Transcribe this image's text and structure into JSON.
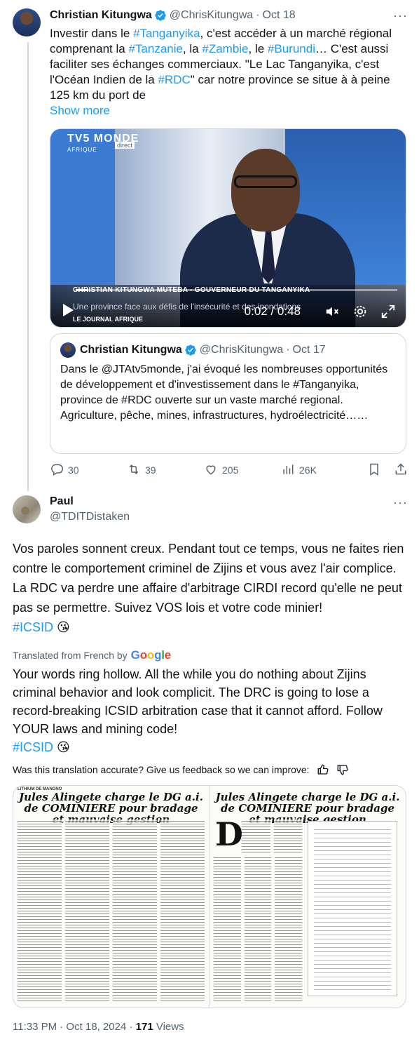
{
  "parent": {
    "name": "Christian Kitungwa",
    "handle": "@ChrisKitungwa",
    "dot": "·",
    "date": "Oct 18",
    "more": "···",
    "text_parts": [
      {
        "t": "Investir dans le ",
        "link": false
      },
      {
        "t": "#Tanganyika",
        "link": true
      },
      {
        "t": ", c'est accéder à un marché régional comprenant la ",
        "link": false
      },
      {
        "t": "#Tanzanie",
        "link": true
      },
      {
        "t": ", la ",
        "link": false
      },
      {
        "t": "#Zambie",
        "link": true
      },
      {
        "t": ", le ",
        "link": false
      },
      {
        "t": "#Burundi",
        "link": true
      },
      {
        "t": "… C'est aussi faciliter ses échanges commerciaux. \"Le Lac Tanganyika, c'est l'Océan Indien de la ",
        "link": false
      },
      {
        "t": "#RDC",
        "link": true
      },
      {
        "t": "\" car notre province se situe à à peine 125 km du port de",
        "link": false
      }
    ],
    "show_more": "Show more",
    "video": {
      "logo": "TV5 MONDE",
      "logo_sub": "AFRIQUE",
      "live_badge": "direct",
      "caption_name": "CHRISTIAN KITUNGWA MUTEBA - GOUVERNEUR DU TANGANYIKA",
      "caption_topic": "Une province face aux défis de l'insécurité et des inondations",
      "caption_show": "LE JOURNAL AFRIQUE",
      "time": "0:02 / 0:48",
      "progress": 0.04
    },
    "quote": {
      "name": "Christian Kitungwa",
      "handle": "@ChrisKitungwa",
      "dot": "·",
      "date": "Oct 17",
      "text": "Dans le @JTAtv5monde, j'ai évoqué les nombreuses opportunités de développement et d'investissement dans le #Tanganyika, province de #RDC ouverte sur un vaste marché regional.\nAgriculture, pêche, mines, infrastructures, hydroélectricité……"
    },
    "actions": {
      "replies": "30",
      "reposts": "39",
      "likes": "205",
      "views": "26K"
    }
  },
  "reply": {
    "name": "Paul",
    "handle": "@TDITDistaken",
    "more": "···",
    "original": "Vos paroles sonnent creux.  Pendant tout ce temps, vous ne faites rien contre le comportement criminel de Zijins et vous avez l'air complice.  La RDC va perdre une affaire d'arbitrage CIRDI record qu'elle ne peut pas se permettre.  Suivez VOS lois et votre code minier!",
    "original_hashtag": "#ICSID",
    "emoji": "😘",
    "translated_label": "Translated from French by",
    "google": [
      "G",
      "o",
      "o",
      "g",
      "l",
      "e"
    ],
    "google_colors": [
      "#4285F4",
      "#EA4335",
      "#FBBC05",
      "#4285F4",
      "#34A853",
      "#EA4335"
    ],
    "translation": "Your words ring hollow. All the while you do nothing about Zijins criminal behavior and look complicit. The DRC is going to lose a record-breaking ICSID arbitration case that it cannot afford. Follow YOUR laws and mining code!",
    "translation_hashtag": "#ICSID",
    "feedback": "Was this translation accurate? Give us feedback so we can improve:",
    "image": {
      "left_kicker": "LITHIUM DE MANONO",
      "headline": "Jules Alingete charge le DG a.i. de COMINIERE pour bradage et mauvaise gestion",
      "drop_cap": "D"
    },
    "footer_time": "11:33 PM · Oct 18, 2024 · ",
    "footer_views_num": "171",
    "footer_views_label": " Views"
  },
  "colors": {
    "link": "#1d9bf0",
    "secondary": "#536471",
    "text": "#0f1419",
    "border": "#cfd9de"
  }
}
